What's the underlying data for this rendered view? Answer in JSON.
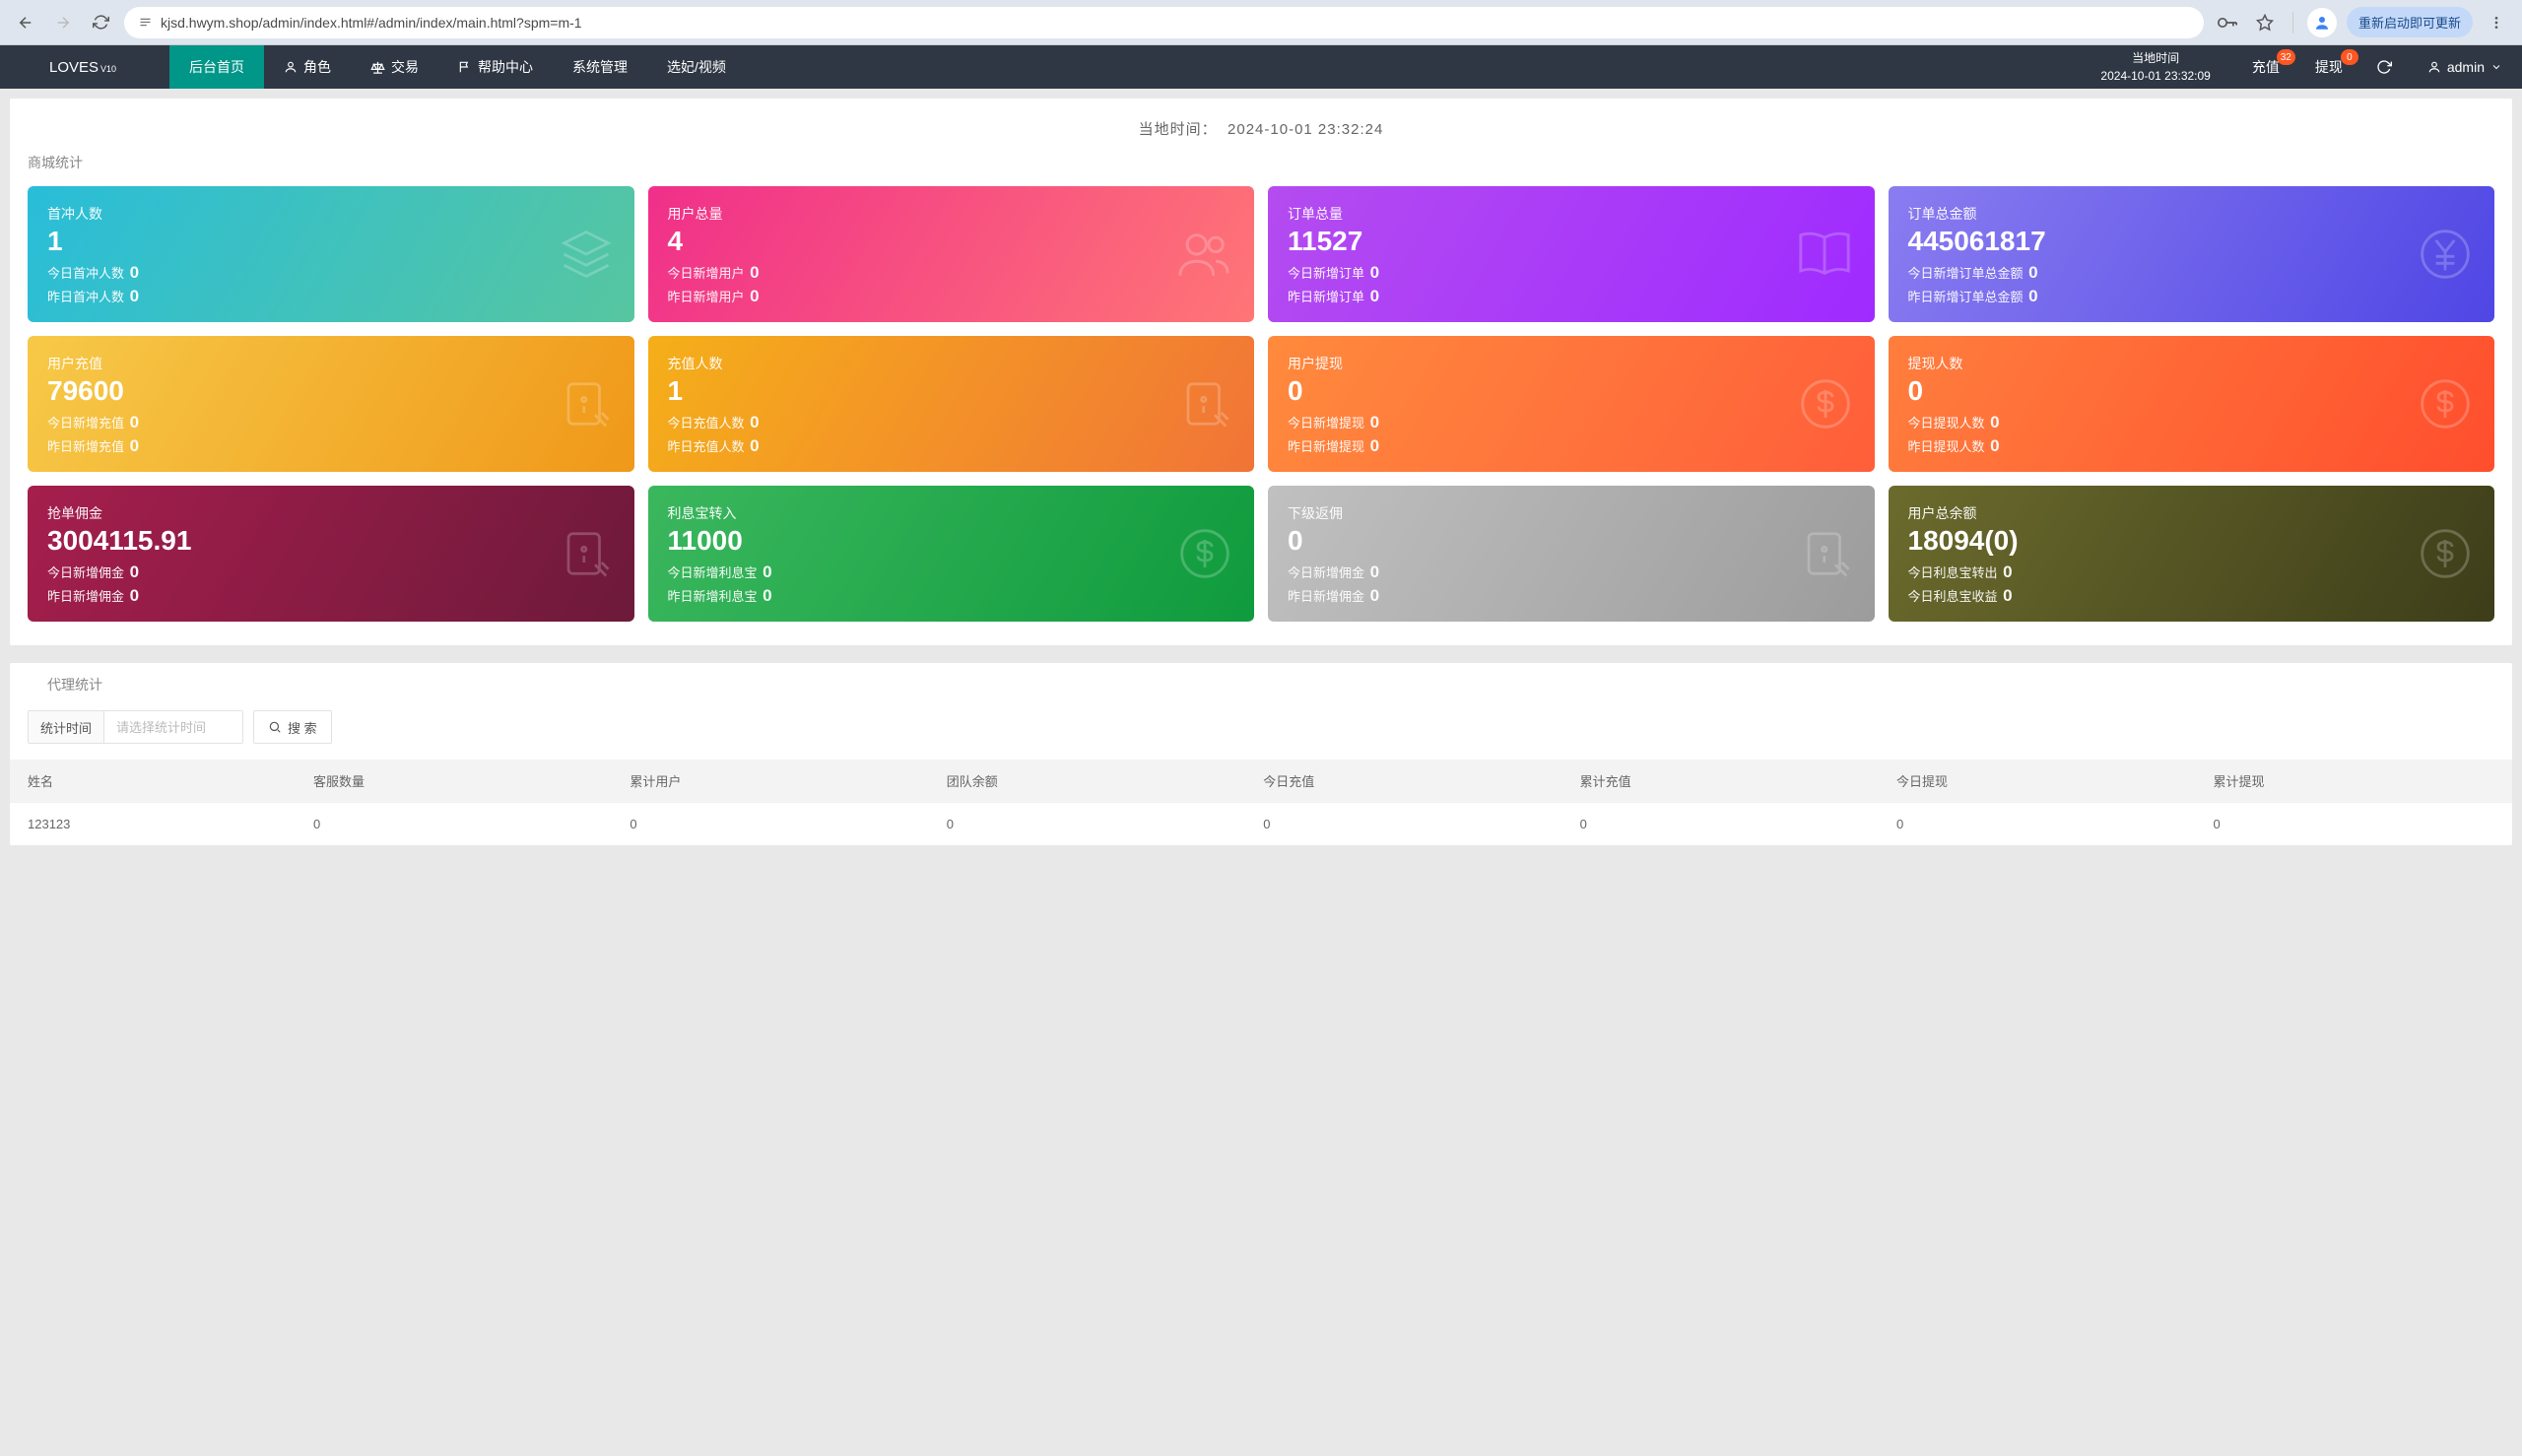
{
  "browser": {
    "url": "kjsd.hwym.shop/admin/index.html#/admin/index/main.html?spm=m-1",
    "restart_label": "重新启动即可更新"
  },
  "logo": {
    "name": "LOVES",
    "ver": "V10"
  },
  "nav": {
    "items": [
      {
        "label": "后台首页"
      },
      {
        "label": "角色"
      },
      {
        "label": "交易"
      },
      {
        "label": "帮助中心"
      },
      {
        "label": "系统管理"
      },
      {
        "label": "选妃/视频"
      }
    ],
    "local_time_label": "当地时间",
    "local_time_value": "2024-10-01 23:32:09",
    "actions": {
      "recharge": {
        "label": "充值",
        "badge": "32"
      },
      "withdraw": {
        "label": "提现",
        "badge": "0"
      }
    },
    "user": "admin"
  },
  "page_time": {
    "label": "当地时间：",
    "value": "2024-10-01 23:32:24"
  },
  "section_title": "商城统计",
  "cards": [
    {
      "cls": "g-teal",
      "icon": "layers",
      "title": "首冲人数",
      "big": "1",
      "row1_label": "今日首冲人数",
      "row1_val": "0",
      "row2_label": "昨日首冲人数",
      "row2_val": "0"
    },
    {
      "cls": "g-pink",
      "icon": "users",
      "title": "用户总量",
      "big": "4",
      "row1_label": "今日新增用户",
      "row1_val": "0",
      "row2_label": "昨日新增用户",
      "row2_val": "0"
    },
    {
      "cls": "g-purple",
      "icon": "book",
      "title": "订单总量",
      "big": "11527",
      "row1_label": "今日新增订单",
      "row1_val": "0",
      "row2_label": "昨日新增订单",
      "row2_val": "0"
    },
    {
      "cls": "g-blue",
      "icon": "yen",
      "title": "订单总金额",
      "big": "445061817",
      "row1_label": "今日新增订单总金额",
      "row1_val": "0",
      "row2_label": "昨日新增订单总金额",
      "row2_val": "0"
    },
    {
      "cls": "g-yellow",
      "icon": "note",
      "title": "用户充值",
      "big": "79600",
      "row1_label": "今日新增充值",
      "row1_val": "0",
      "row2_label": "昨日新增充值",
      "row2_val": "0"
    },
    {
      "cls": "g-orange1",
      "icon": "note",
      "title": "充值人数",
      "big": "1",
      "row1_label": "今日充值人数",
      "row1_val": "0",
      "row2_label": "昨日充值人数",
      "row2_val": "0"
    },
    {
      "cls": "g-orange2",
      "icon": "dollar",
      "title": "用户提现",
      "big": "0",
      "row1_label": "今日新增提现",
      "row1_val": "0",
      "row2_label": "昨日新增提现",
      "row2_val": "0"
    },
    {
      "cls": "g-orange3",
      "icon": "dollar",
      "title": "提现人数",
      "big": "0",
      "row1_label": "今日提现人数",
      "row1_val": "0",
      "row2_label": "昨日提现人数",
      "row2_val": "0"
    },
    {
      "cls": "g-maroon",
      "icon": "note",
      "title": "抢单佣金",
      "big": "3004115.91",
      "row1_label": "今日新增佣金",
      "row1_val": "0",
      "row2_label": "昨日新增佣金",
      "row2_val": "0"
    },
    {
      "cls": "g-green",
      "icon": "dollar",
      "title": "利息宝转入",
      "big": "11000",
      "row1_label": "今日新增利息宝",
      "row1_val": "0",
      "row2_label": "昨日新增利息宝",
      "row2_val": "0"
    },
    {
      "cls": "g-gray",
      "icon": "note",
      "title": "下级返佣",
      "big": "0",
      "row1_label": "今日新增佣金",
      "row1_val": "0",
      "row2_label": "昨日新增佣金",
      "row2_val": "0"
    },
    {
      "cls": "g-olive",
      "icon": "dollar",
      "title": "用户总余额",
      "big": "18094(0)",
      "row1_label": "今日利息宝转出",
      "row1_val": "0",
      "row2_label": "今日利息宝收益",
      "row2_val": "0"
    }
  ],
  "agent": {
    "title": "代理统计",
    "filter_label": "统计时间",
    "filter_placeholder": "请选择统计时间",
    "search_label": "搜 索",
    "columns": [
      "姓名",
      "客服数量",
      "累计用户",
      "团队余额",
      "今日充值",
      "累计充值",
      "今日提现",
      "累计提现"
    ],
    "rows": [
      [
        "123123",
        "0",
        "0",
        "0",
        "0",
        "0",
        "0",
        "0"
      ]
    ]
  }
}
